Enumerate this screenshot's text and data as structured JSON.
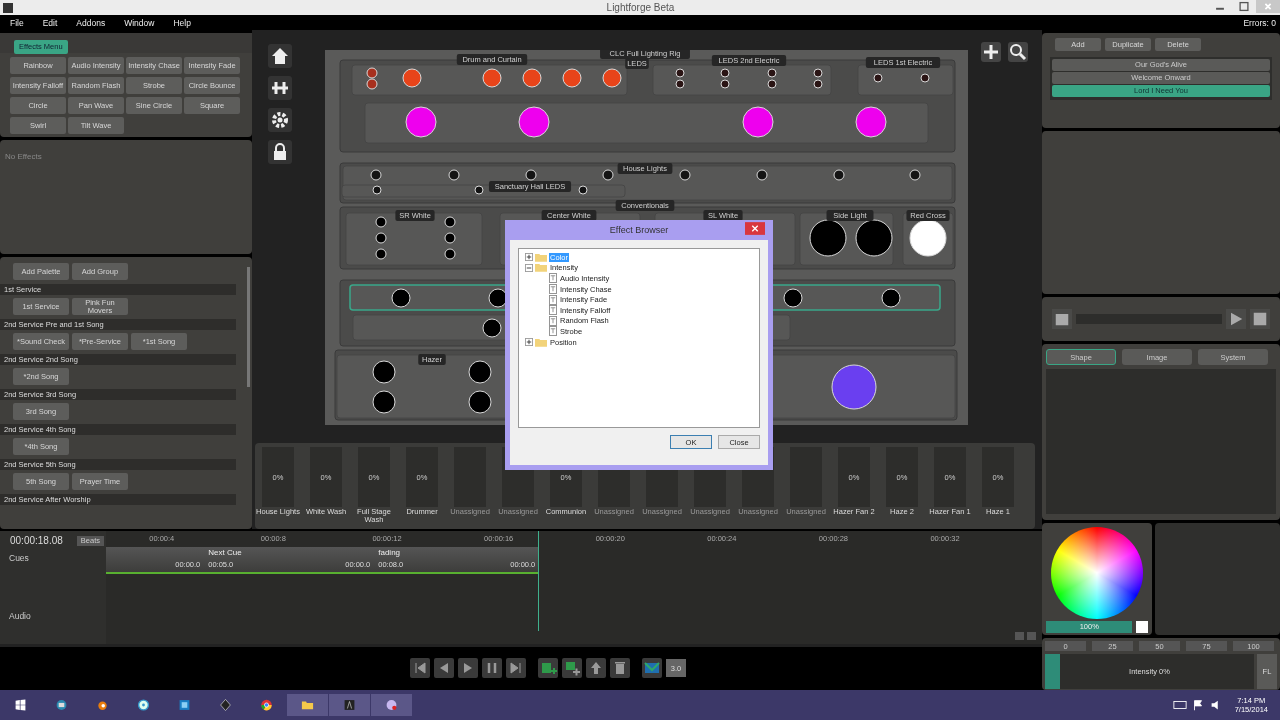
{
  "window": {
    "title": "Lightforge Beta"
  },
  "menu": [
    "File",
    "Edit",
    "Addons",
    "Window",
    "Help"
  ],
  "errors": "Errors: 0",
  "effects": {
    "menu_button": "Effects Menu",
    "buttons": [
      "Rainbow",
      "Audio Intensity",
      "Intensity Chase",
      "Intensity Fade",
      "Intensity Falloff",
      "Random Flash",
      "Strobe",
      "Circle Bounce",
      "Circle",
      "Pan Wave",
      "Sine Circle",
      "Square",
      "Swirl",
      "Tilt Wave"
    ],
    "empty": "No Effects"
  },
  "palettes": {
    "actions": [
      "Add Palette",
      "Add Group"
    ],
    "groups": [
      {
        "title": "1st Service",
        "items": [
          "1st Service",
          "Pink Fun Movers"
        ]
      },
      {
        "title": "2nd Service Pre and 1st Song",
        "items": [
          "*Sound Check",
          "*Pre-Service",
          "*1st Song"
        ]
      },
      {
        "title": "2nd Service 2nd Song",
        "items": [
          "*2nd Song"
        ]
      },
      {
        "title": "2nd Service 3rd Song",
        "items": [
          "3rd Song"
        ]
      },
      {
        "title": "2nd Service 4th Song",
        "items": [
          "*4th Song"
        ]
      },
      {
        "title": "2nd Service 5th Song",
        "items": [
          "5th Song",
          "Prayer Time"
        ]
      },
      {
        "title": "2nd Service After Worship"
      }
    ]
  },
  "stage": {
    "title": "CLC Full Lighting Rig",
    "groups": [
      {
        "label": "Drum and Curtain",
        "selected": false,
        "fixtures": [
          {
            "color": "#a8301e"
          },
          {
            "color": "#a8301e"
          },
          {
            "color": "#e8441a"
          },
          {
            "color": "#e8441a"
          },
          {
            "color": "#e8441a"
          },
          {
            "color": "#e8441a"
          },
          {
            "color": "#e8441a"
          }
        ]
      },
      {
        "label": "LEDS",
        "selected": false
      },
      {
        "label": "LEDS 2nd Electric",
        "selected": false,
        "fixtures": [
          {
            "color": "#2a1414"
          },
          {
            "color": "#2a1414"
          },
          {
            "color": "#2a1414"
          },
          {
            "color": "#2a1414"
          },
          {
            "color": "#2a1414"
          },
          {
            "color": "#2a1414"
          },
          {
            "color": "#2a1414"
          },
          {
            "color": "#2a1414"
          }
        ]
      },
      {
        "label": "LEDS 1st Electric",
        "selected": false,
        "fixtures": [
          {
            "color": "#2a1414"
          },
          {
            "color": "#2a1414"
          }
        ]
      },
      {
        "selected": false,
        "fixtures": [
          {
            "color": "#ee00ee"
          },
          {
            "color": "#ee00ee"
          },
          {
            "color": "#ee00ee"
          },
          {
            "color": "#ee00ee"
          }
        ]
      },
      {
        "label": "House Lights",
        "selected": false,
        "fixtures": [
          {
            "color": "#141414"
          },
          {
            "color": "#141414"
          },
          {
            "color": "#141414"
          },
          {
            "color": "#141414"
          },
          {
            "color": "#141414"
          },
          {
            "color": "#141414"
          },
          {
            "color": "#141414"
          },
          {
            "color": "#141414"
          }
        ]
      },
      {
        "label": "Sanctuary Hall LEDS",
        "selected": false,
        "fixtures": [
          {
            "color": "#141414"
          },
          {
            "color": "#141414"
          },
          {
            "color": "#141414"
          }
        ]
      },
      {
        "label": "Conventionals",
        "selected": false
      },
      {
        "label": "SR White",
        "selected": false,
        "fixtures": [
          {
            "color": "#000000"
          },
          {
            "color": "#000000"
          },
          {
            "color": "#000000"
          },
          {
            "color": "#000000"
          },
          {
            "color": "#000000"
          },
          {
            "color": "#000000"
          }
        ]
      },
      {
        "label": "Center White",
        "selected": false
      },
      {
        "label": "SL White",
        "selected": false
      },
      {
        "label": "Side Light",
        "selected": false,
        "fixtures": [
          {
            "color": "#000000"
          },
          {
            "color": "#000000"
          }
        ]
      },
      {
        "label": "Red Cross",
        "selected": false,
        "fixtures": [
          {
            "color": "#ffffff"
          }
        ]
      },
      {
        "selected": true,
        "fixtures": [
          {
            "color": "#000000"
          },
          {
            "color": "#000000"
          },
          {
            "color": "#000000"
          },
          {
            "color": "#000000"
          }
        ]
      },
      {
        "selected": false,
        "fixtures": [
          {
            "color": "#000000"
          }
        ]
      },
      {
        "label": "Hazer",
        "selected": false,
        "fixtures": [
          {
            "color": "#000000"
          },
          {
            "color": "#000000"
          },
          {
            "color": "#000000"
          },
          {
            "color": "#000000"
          },
          {
            "color": "#6a3ff0"
          }
        ]
      }
    ]
  },
  "faders": [
    {
      "label": "House Lights",
      "assigned": true,
      "value": "0%"
    },
    {
      "label": "White Wash",
      "assigned": true,
      "value": "0%"
    },
    {
      "label": "Full Stage Wash",
      "assigned": true,
      "value": "0%"
    },
    {
      "label": "Drummer",
      "assigned": true,
      "value": "0%"
    },
    {
      "label": "Unassigned",
      "assigned": false
    },
    {
      "label": "Unassigned",
      "assigned": false
    },
    {
      "label": "Communion",
      "assigned": true,
      "value": "0%"
    },
    {
      "label": "Unassigned",
      "assigned": false
    },
    {
      "label": "Unassigned",
      "assigned": false
    },
    {
      "label": "Unassigned",
      "assigned": false
    },
    {
      "label": "Unassigned",
      "assigned": false
    },
    {
      "label": "Unassigned",
      "assigned": false
    },
    {
      "label": "Hazer Fan 2",
      "assigned": true,
      "value": "0%"
    },
    {
      "label": "Haze 2",
      "assigned": true,
      "value": "0%"
    },
    {
      "label": "Hazer Fan 1",
      "assigned": true,
      "value": "0%"
    },
    {
      "label": "Haze 1",
      "assigned": true,
      "value": "0%"
    }
  ],
  "timeline": {
    "time": "00:00:18.08",
    "beats": "Beats",
    "tracks": [
      "Cues",
      "Audio"
    ],
    "ticks": [
      "00:00:4",
      "00:00:8",
      "00:00:12",
      "00:00:16",
      "00:00:20",
      "00:00:24",
      "00:00:28",
      "00:00:32"
    ],
    "lead_in_end": "00:00.0",
    "cues": [
      {
        "label": "Next Cue",
        "time": "00:05.0",
        "end_time": "00:00.0"
      },
      {
        "label": "fading",
        "time": "00:08.0",
        "end_time": "00:00.0"
      }
    ]
  },
  "transport": {
    "speed": "3.0"
  },
  "media": {
    "level": 0
  },
  "cue_lists": {
    "actions": [
      "Add",
      "Duplicate",
      "Delete"
    ],
    "items": [
      {
        "label": "Our God's Alive",
        "selected": false
      },
      {
        "label": "Welcome Onward",
        "selected": false
      },
      {
        "label": "Lord I Need You",
        "selected": true
      }
    ]
  },
  "tabs": [
    {
      "label": "Shape",
      "selected": true
    },
    {
      "label": "Image",
      "selected": false
    },
    {
      "label": "System",
      "selected": false
    }
  ],
  "color": {
    "level": 1,
    "reading": "100%"
  },
  "intensity": {
    "scale": [
      "0",
      "25",
      "50",
      "75",
      "100"
    ],
    "level": 0.07,
    "reading": "Intensity 0%",
    "button": "FL"
  },
  "dialog": {
    "title": "Effect Browser",
    "tree": [
      {
        "label": "Color",
        "kind": "folder",
        "expanded": false,
        "selected": true
      },
      {
        "label": "Intensity",
        "kind": "folder",
        "expanded": true,
        "selected": false,
        "children": [
          {
            "label": "Audio Intensity",
            "kind": "effect",
            "selected": false
          },
          {
            "label": "Intensity Chase",
            "kind": "effect",
            "selected": false
          },
          {
            "label": "Intensity Fade",
            "kind": "effect",
            "selected": false
          },
          {
            "label": "Intensity Falloff",
            "kind": "effect",
            "selected": false
          },
          {
            "label": "Random Flash",
            "kind": "effect",
            "selected": false
          },
          {
            "label": "Strobe",
            "kind": "effect",
            "selected": false
          }
        ]
      },
      {
        "label": "Position",
        "kind": "folder",
        "expanded": false,
        "selected": false
      }
    ],
    "buttons": [
      "OK",
      "Close"
    ]
  },
  "clock": {
    "time": "7:14 PM",
    "date": "7/15/2014"
  }
}
